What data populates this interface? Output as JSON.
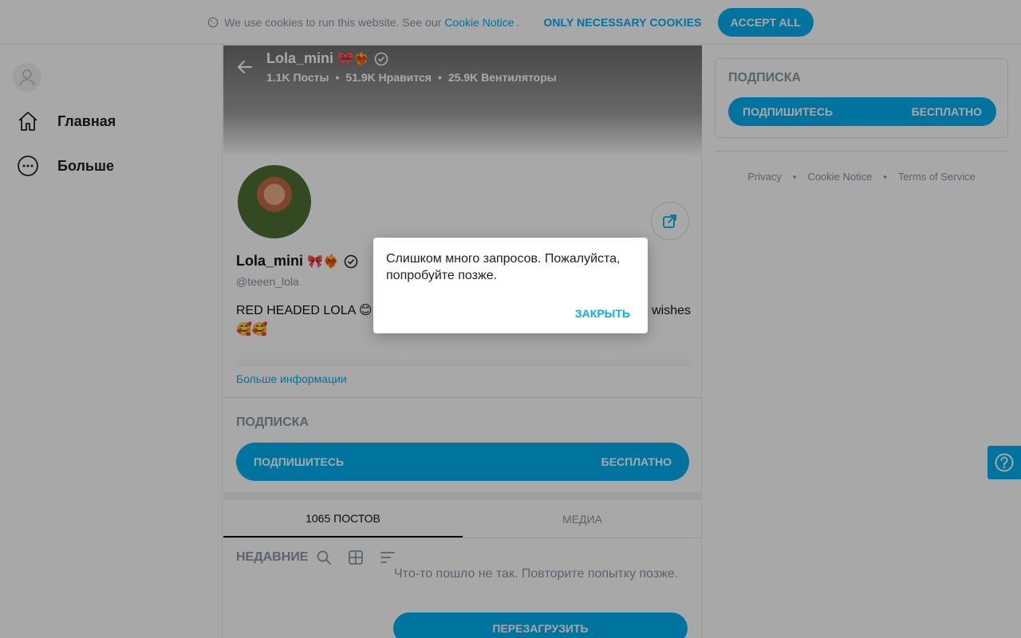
{
  "cookie_bar": {
    "text": "We use cookies to run this website. See our",
    "link": "Cookie Notice",
    "dot": ".",
    "necessary_label": "ONLY NECESSARY COOKIES",
    "accept_label": "ACCEPT ALL"
  },
  "sidebar": {
    "items": [
      {
        "label": "Главная",
        "icon": "home-icon"
      },
      {
        "label": "Больше",
        "icon": "more-icon"
      }
    ]
  },
  "profile": {
    "name": "Lola_mini",
    "name_emojis": "🎀❤️‍🔥",
    "stats": {
      "posts": "1.1K Посты",
      "likes": "51.9K Нравится",
      "fans": "25.9K Вентиляторы",
      "separator": "•"
    },
    "handle": "@teeen_lola",
    "bio_start": "RED HEADED LOLA 😊 T",
    "bio_end": "wishes",
    "bio_emojis": "🥰🥰",
    "more_info": "Больше информации"
  },
  "subscription": {
    "label": "ПОДПИСКА",
    "button_left": "ПОДПИШИТЕСЬ",
    "button_right": "БЕСПЛАТНО"
  },
  "tabs": [
    {
      "label": "1065 ПОСТОВ",
      "active": true
    },
    {
      "label": "МЕДИА",
      "active": false
    }
  ],
  "feed": {
    "filter_label": "НЕДАВНИЕ",
    "error": "Что-то пошло не так. Повторите попытку позже.",
    "reload": "ПЕРЕЗАГРУЗИТЬ"
  },
  "right": {
    "label": "ПОДПИСКА",
    "button_left": "ПОДПИШИТЕСЬ",
    "button_right": "БЕСПЛАТНО",
    "footer": [
      "Privacy",
      "Cookie Notice",
      "Terms of Service"
    ],
    "footer_separator": "•"
  },
  "modal": {
    "message": "Слишком много запросов. Пожалуйста, попробуйте позже.",
    "close_label": "ЗАКРЫТЬ"
  },
  "colors": {
    "accent": "#00aff0",
    "muted": "#8a96a3"
  }
}
